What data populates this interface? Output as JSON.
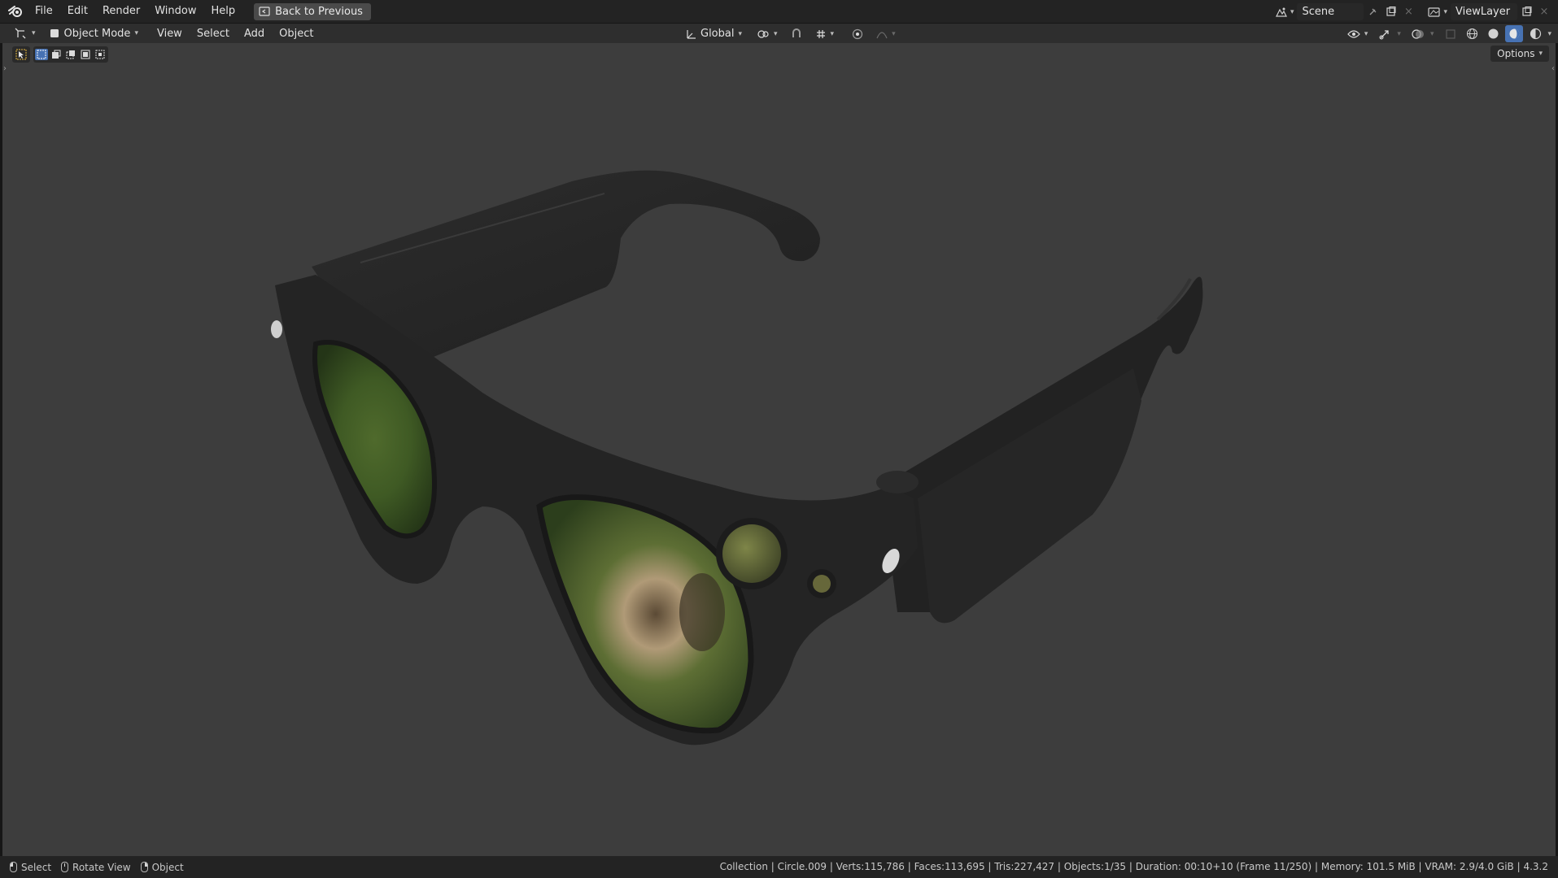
{
  "topbar": {
    "menu": [
      "File",
      "Edit",
      "Render",
      "Window",
      "Help"
    ],
    "back_label": "Back to Previous",
    "scene_name": "Scene",
    "view_layer": "ViewLayer"
  },
  "header": {
    "mode": "Object Mode",
    "menus": [
      "View",
      "Select",
      "Add",
      "Object"
    ],
    "orientation": "Global"
  },
  "viewport": {
    "options_label": "Options",
    "background_color": "#3d3d3d"
  },
  "statusbar": {
    "hint_select": "Select",
    "hint_rotate": "Rotate View",
    "hint_object": "Object",
    "stats": "Collection | Circle.009 | Verts:115,786 | Faces:113,695 | Tris:227,427 | Objects:1/35 | Duration: 00:10+10 (Frame 11/250) | Memory: 101.5 MiB | VRAM: 2.9/4.0 GiB | 4.3.2"
  },
  "icons": {
    "logo": "blender-logo-icon",
    "editor": "3d-viewport-icon",
    "select_tool": "select-cursor-icon"
  }
}
